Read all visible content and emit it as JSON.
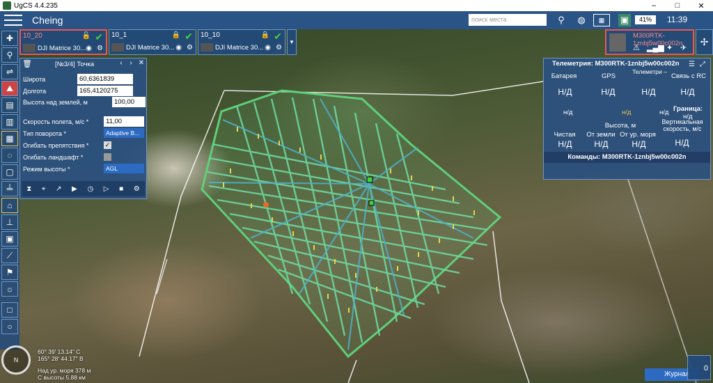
{
  "window": {
    "title": "UgCS 4.4.235",
    "controls": [
      "–",
      "□",
      "✕"
    ]
  },
  "header": {
    "mission_title": "Cheing",
    "search_placeholder": "поиск места",
    "battery": "41%",
    "clock": "11:39"
  },
  "routes": [
    {
      "name": "10_20",
      "vehicle": "DJI Matrice 30...",
      "selected": true
    },
    {
      "name": "10_1",
      "vehicle": "DJI Matrice 30...",
      "selected": false
    },
    {
      "name": "10_10",
      "vehicle": "DJI Matrice 30...",
      "selected": false
    }
  ],
  "waypoint": {
    "title": "[№3/4] Точка",
    "lat_label": "Широта",
    "lat_value": "60,6361839",
    "lon_label": "Долгота",
    "lon_value": "165,4120275",
    "height_label": "Высота над землей, м",
    "height_value": "100,00",
    "speed_label": "Скорость полета, м/с *",
    "speed_value": "11,00",
    "turn_label": "Тип поворота *",
    "turn_value": "Adaptive B...",
    "avoid_label": "Огибать препятствия *",
    "terrain_label": "Огибать ландшафт *",
    "alt_mode_label": "Режим высоты *",
    "alt_mode_value": "AGL"
  },
  "vehicle": {
    "name": "M300RTK-1znbj5w00c002n"
  },
  "telemetry": {
    "title": "Телеметрия: M300RTK-1znbj5w00c002n",
    "col1": "Батарея",
    "col2": "GPS",
    "col3": "Телеметри –",
    "col4": "Связь с RC",
    "na": "Н/Д",
    "na_small": "н/д",
    "border_label": "Граница:",
    "height_label": "Высота, м",
    "vspeed_label": "Вертикальная скорость, м/с",
    "clean": "Чистая",
    "from_ground": "От земли",
    "from_sea": "От ур. моря",
    "commands_title": "Команды: M300RTK-1znbj5w00c002n"
  },
  "map_info": {
    "lat": "60° 39' 13.14\" С",
    "lon": "165° 28' 44.17\" В",
    "sea_alt": "Над ур. моря 378 м",
    "cam_alt": "С высоты 5.88 км"
  },
  "journal": {
    "label": "Журнал",
    "count": "0"
  },
  "colors": {
    "panel": "#2a5086",
    "accent": "#2d6bc2",
    "route": "#5fd07a",
    "ok": "#3fd13f"
  }
}
